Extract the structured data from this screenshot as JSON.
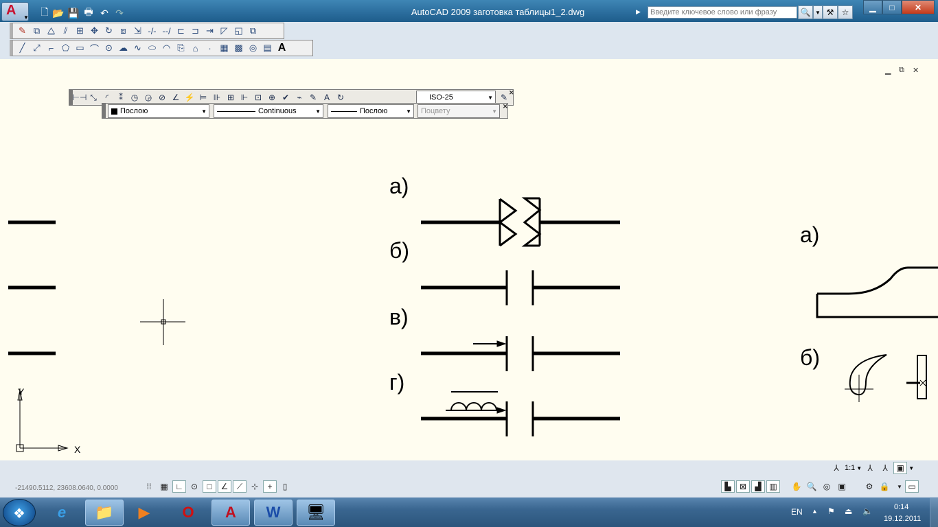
{
  "window": {
    "title": "AutoCAD 2009 заготовка таблицы1_2.dwg",
    "search_placeholder": "Введите ключевое слово или фразу"
  },
  "properties_toolbar": {
    "dimstyle": "ISO-25",
    "color": "Послою",
    "linetype": "Continuous",
    "lineweight": "Послою",
    "plotstyle": "Поцвету"
  },
  "drawing": {
    "labels_center": [
      "а)",
      "б)",
      "в)",
      "г)"
    ],
    "labels_right": [
      "а)",
      "б)"
    ],
    "ucs": {
      "x": "X",
      "y": "Y"
    }
  },
  "status": {
    "coordinates": "-21490.5112, 23608.0640, 0.0000",
    "scale": "1:1"
  },
  "taskbar": {
    "language": "EN",
    "time": "0:14",
    "date": "19.12.2011"
  },
  "icons": {
    "quick_access": [
      "new-icon",
      "open-icon",
      "save-icon",
      "print-icon",
      "undo-icon",
      "redo-icon"
    ],
    "modify": [
      "erase-icon",
      "copy-icon",
      "mirror-icon",
      "offset-icon",
      "array-icon",
      "move-icon",
      "rotate-icon",
      "scale-icon",
      "stretch-icon",
      "trim-icon",
      "extend-icon",
      "break-icon",
      "join-icon",
      "chamfer-icon",
      "fillet-icon",
      "explode-icon"
    ],
    "draw": [
      "line-icon",
      "xline-icon",
      "polyline-icon",
      "polygon-icon",
      "rectangle-icon",
      "arc-icon",
      "circle-icon",
      "revcloud-icon",
      "spline-icon",
      "ellipse-icon",
      "ellipse-arc-icon",
      "insert-block-icon",
      "make-block-icon",
      "point-icon",
      "hatch-icon",
      "gradient-icon",
      "region-icon",
      "table-icon",
      "mtext-icon"
    ]
  }
}
